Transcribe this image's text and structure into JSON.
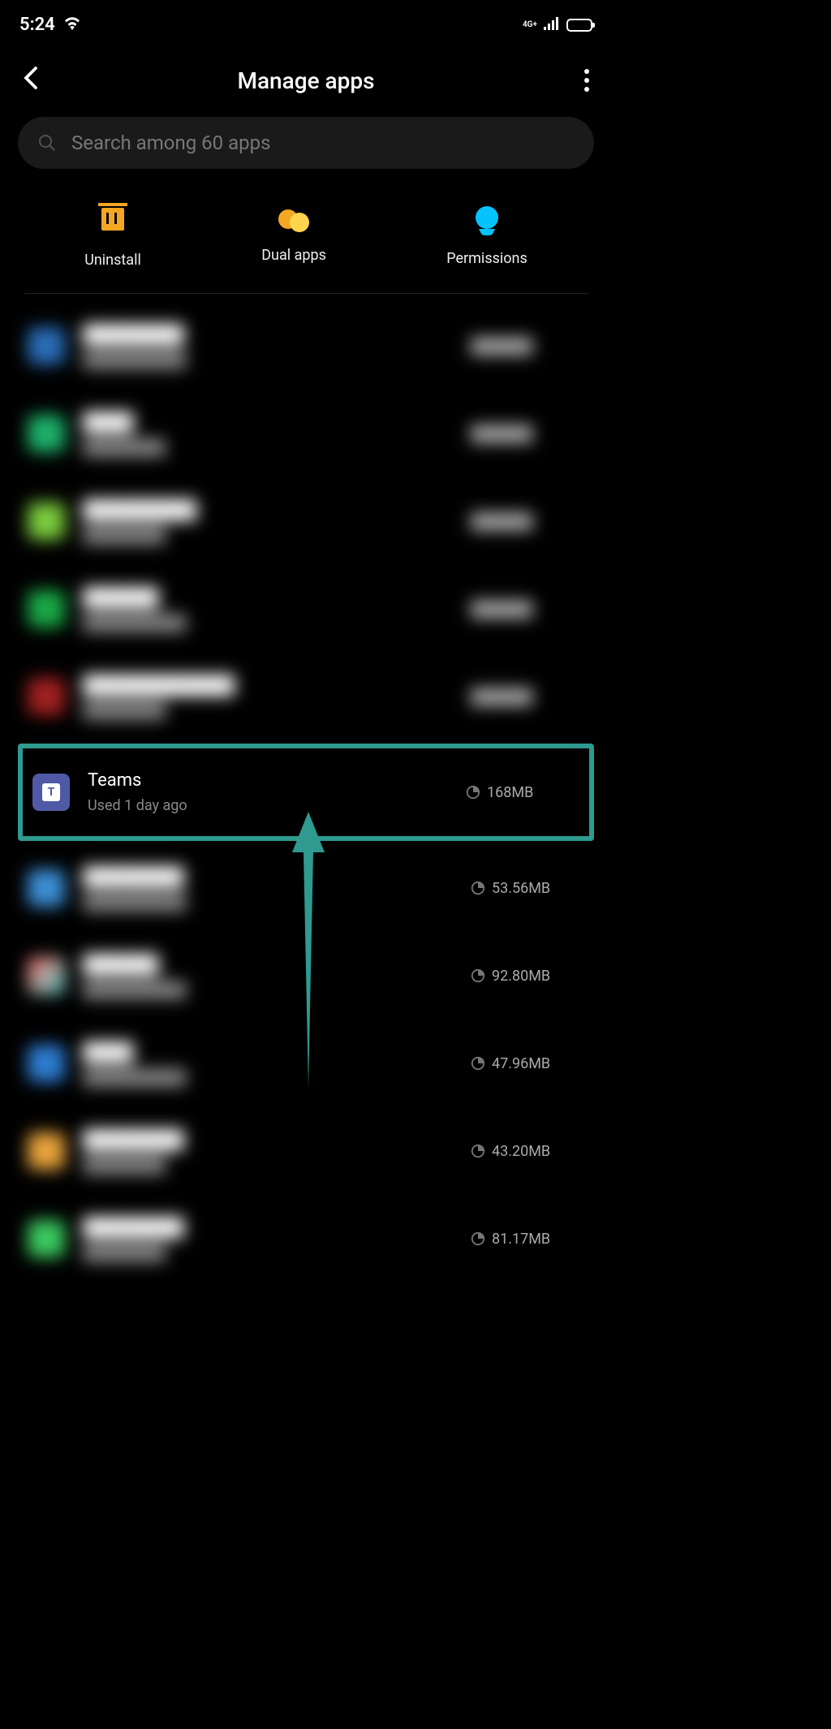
{
  "status_bar": {
    "time": "5:24",
    "network_label": "4G+"
  },
  "header": {
    "title": "Manage apps"
  },
  "search": {
    "placeholder": "Search among 60 apps"
  },
  "actions": {
    "uninstall": "Uninstall",
    "dual_apps": "Dual apps",
    "permissions": "Permissions"
  },
  "highlighted_app": {
    "name": "Teams",
    "usage": "Used 1 day ago",
    "size": "168MB"
  },
  "visible_sizes": {
    "row6": "53.56MB",
    "row7": "92.80MB",
    "row8": "47.96MB",
    "row9": "43.20MB",
    "row10": "81.17MB"
  }
}
